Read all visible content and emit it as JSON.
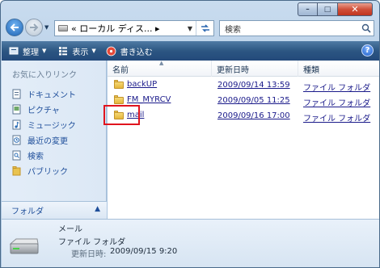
{
  "window": {
    "min_glyph": "–",
    "max_glyph": "□",
    "close_glyph": "✕"
  },
  "address": {
    "prefix": "«",
    "path": "ローカル ディス...",
    "sep": "▸"
  },
  "search": {
    "placeholder": "検索"
  },
  "toolbar": {
    "organize": "整理",
    "views": "表示",
    "burn": "書き込む",
    "help": "?"
  },
  "sidebar": {
    "favorites_header": "お気に入りリンク",
    "items": [
      {
        "label": "ドキュメント",
        "icon": "documents-icon"
      },
      {
        "label": "ピクチャ",
        "icon": "pictures-icon"
      },
      {
        "label": "ミュージック",
        "icon": "music-icon"
      },
      {
        "label": "最近の変更",
        "icon": "recent-changes-icon"
      },
      {
        "label": "検索",
        "icon": "searches-icon"
      },
      {
        "label": "パブリック",
        "icon": "public-folder-icon"
      }
    ],
    "folders_label": "フォルダ"
  },
  "columns": {
    "name": "名前",
    "date": "更新日時",
    "type": "種類"
  },
  "files": [
    {
      "name": "backUP",
      "date": "2009/09/14 13:59",
      "type": "ファイル フォルダ"
    },
    {
      "name": "FM_MYRCV",
      "date": "2009/09/05 11:25",
      "type": "ファイル フォルダ"
    },
    {
      "name": "mail",
      "date": "2009/09/16 17:00",
      "type": "ファイル フォルダ"
    }
  ],
  "details": {
    "name": "メール",
    "type": "ファイル フォルダ",
    "date_label": "更新日時:",
    "date_value": "2009/09/15 9:20"
  },
  "colors": {
    "highlight": "#e0141e",
    "toolbar": "#2c5682",
    "link": "#1e4e9a"
  }
}
